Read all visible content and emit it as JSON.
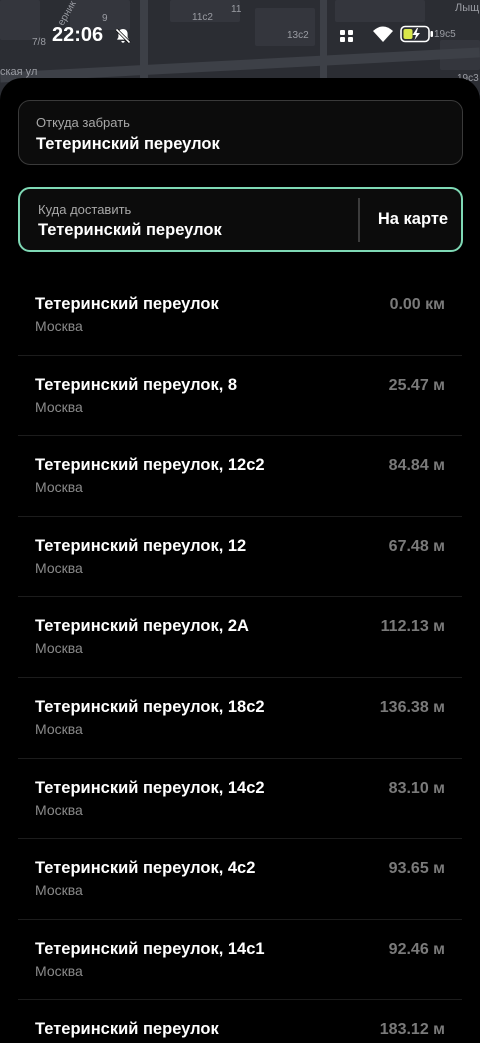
{
  "status_bar": {
    "time": "22:06",
    "battery_color": "#d8e64a"
  },
  "map_labels": [
    "7/8",
    "9",
    "11c2",
    "11",
    "13c2",
    "19c5",
    "19c3",
    "ская ул",
    "Лыщ",
    "ерник"
  ],
  "pickup": {
    "caption": "Откуда забрать",
    "value": "Тетеринский переулок"
  },
  "destination": {
    "caption": "Куда доставить",
    "value": "Тетеринский переулок",
    "map_button": "На карте",
    "accent": "#7fd9b5"
  },
  "results": [
    {
      "name": "Тетеринский переулок",
      "city": "Москва",
      "distance": "0.00 км"
    },
    {
      "name": "Тетеринский переулок, 8",
      "city": "Москва",
      "distance": "25.47 м"
    },
    {
      "name": "Тетеринский переулок, 12с2",
      "city": "Москва",
      "distance": "84.84 м"
    },
    {
      "name": "Тетеринский переулок, 12",
      "city": "Москва",
      "distance": "67.48 м"
    },
    {
      "name": "Тетеринский переулок, 2А",
      "city": "Москва",
      "distance": "112.13 м"
    },
    {
      "name": "Тетеринский переулок, 18с2",
      "city": "Москва",
      "distance": "136.38 м"
    },
    {
      "name": "Тетеринский переулок, 14с2",
      "city": "Москва",
      "distance": "83.10 м"
    },
    {
      "name": "Тетеринский переулок, 4с2",
      "city": "Москва",
      "distance": "93.65 м"
    },
    {
      "name": "Тетеринский переулок, 14с1",
      "city": "Москва",
      "distance": "92.46 м"
    },
    {
      "name": "Тетеринский переулок",
      "city": "",
      "distance": "183.12 м"
    }
  ]
}
